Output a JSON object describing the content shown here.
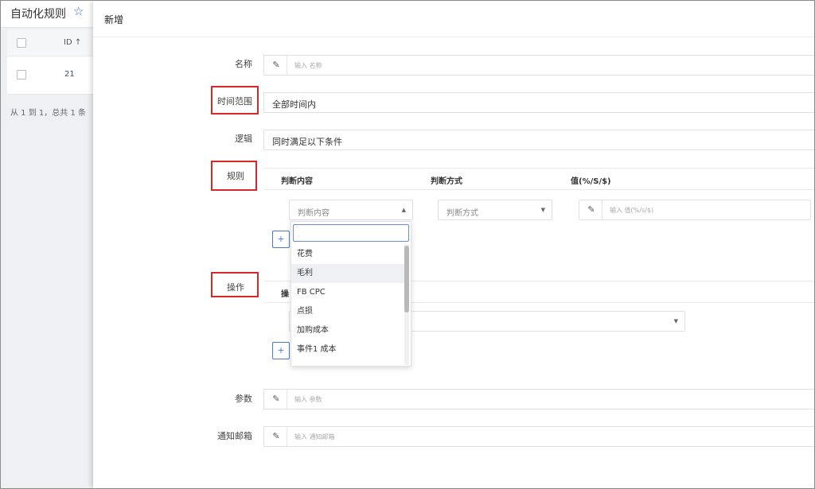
{
  "background_page": {
    "title": "自动化规则",
    "star_icon": "☆",
    "table": {
      "id_header": "ID ↑",
      "rows": [
        {
          "id": "21"
        }
      ]
    },
    "pager": "从 1 到 1，总共 1 条"
  },
  "modal": {
    "title": "新增",
    "fields": {
      "name": {
        "label": "名称",
        "placeholder": "输入 名称"
      },
      "time_range": {
        "label": "时间范围",
        "value": "全部时间内"
      },
      "logic": {
        "label": "逻辑",
        "value": "同时满足以下条件"
      },
      "rules": {
        "label": "规则",
        "columns": [
          "判断内容",
          "判断方式",
          "值(%/S/$)"
        ],
        "content_select": "判断内容",
        "method_select": "判断方式",
        "value_placeholder": "输入 值(%/s/$)",
        "add_label": "+"
      },
      "operation": {
        "label": "操作",
        "column_partial": "操",
        "add_label": "+"
      },
      "params": {
        "label": "参数",
        "placeholder": "输入 参数"
      },
      "email": {
        "label": "通知邮箱",
        "placeholder": "输入 通知邮箱"
      }
    },
    "dropdown": {
      "search_value": "",
      "items": [
        "花费",
        "毛利",
        "FB CPC",
        "点损",
        "加购成本",
        "事件1 成本"
      ],
      "hovered_index": 1
    }
  },
  "colors": {
    "highlight_red": "#d6282b",
    "accent_blue": "#4a78d4"
  }
}
